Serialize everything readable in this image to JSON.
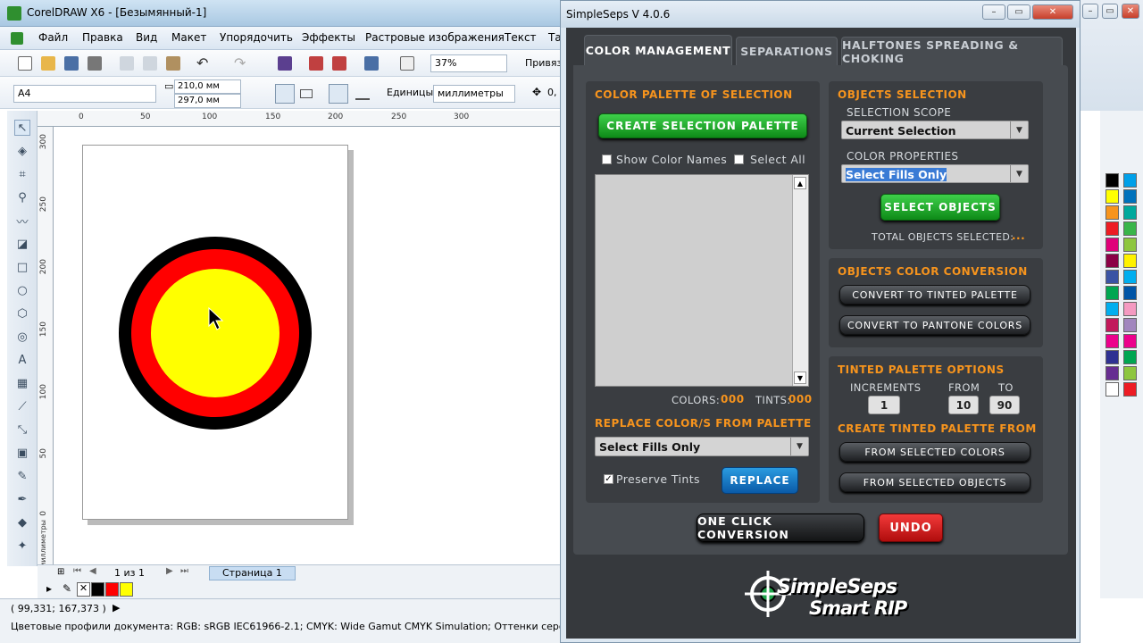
{
  "corel": {
    "window_title": "CorelDRAW X6 - [Безымянный-1]",
    "menu": [
      "Файл",
      "Правка",
      "Вид",
      "Макет",
      "Упорядочить",
      "Эффекты",
      "Растровые изображения",
      "Текст",
      "Та"
    ],
    "toolbar": {
      "zoom": "37%",
      "snap_label": "Привяз"
    },
    "property_bar": {
      "page_size": "A4",
      "width": "210,0 мм",
      "height": "297,0 мм",
      "units_label": "Единицы:",
      "units_value": "миллиметры",
      "nudge": "0,"
    },
    "ruler_h": [
      "0",
      "50",
      "100",
      "150",
      "200",
      "250",
      "300"
    ],
    "ruler_v": [
      "300",
      "250",
      "200",
      "150",
      "100",
      "50",
      "0"
    ],
    "ruler_unit": "миллиметры",
    "page_nav": {
      "counter": "1 из 1",
      "page_tab": "Страница 1"
    },
    "status": {
      "coords": "( 99,331; 167,373 )",
      "profiles": "Цветовые профили документа: RGB: sRGB IEC61966-2.1; CMYK: Wide Gamut CMYK Simulation; Оттенки серого: Gray Gamm"
    },
    "target_colors": {
      "outer": "#000000",
      "middle": "#ff0000",
      "inner": "#ffff00"
    },
    "palette_colors": [
      "#000000",
      "#ffff00",
      "#f7941d",
      "#ed1c24",
      "#e0007a",
      "#8b0046",
      "#3a53a4",
      "#00a651",
      "#00aeef",
      "#c2185b",
      "#ec008c",
      "#2e3192",
      "#662d91",
      "#ffffff",
      "#00a0e9",
      "#0072bc",
      "#00a99d",
      "#39b54a",
      "#8dc63f",
      "#fff200",
      "#00aeef",
      "#0054a6",
      "#f49ac1",
      "#a186be",
      "#ec008c",
      "#00a651",
      "#8dc63f",
      "#ed1c24"
    ]
  },
  "simpleseps": {
    "title": "SimpleSeps V 4.0.6",
    "tabs": [
      "COLOR MANAGEMENT",
      "SEPARATIONS",
      "HALFTONES SPREADING & CHOKING"
    ],
    "palette_group": {
      "header": "COLOR PALETTE OF SELECTION",
      "create_button": "CREATE SELECTION PALETTE",
      "show_color_names": "Show Color Names",
      "select_all": "Select All",
      "colors_label": "COLORS:",
      "colors_value": "000",
      "tints_label": "TINTS:",
      "tints_value": "000",
      "replace_header": "REPLACE COLOR/S FROM PALETTE",
      "replace_select": "Select Fills Only",
      "preserve_tints": "Preserve Tints",
      "replace_button": "REPLACE"
    },
    "objects_selection": {
      "header": "OBJECTS SELECTION",
      "scope_label": "SELECTION SCOPE",
      "scope_value": "Current Selection",
      "props_label": "COLOR PROPERTIES",
      "props_value": "Select Fills Only",
      "select_button": "SELECT OBJECTS",
      "total_label": "TOTAL OBJECTS SELECTED:",
      "total_value": "..."
    },
    "conversion": {
      "header": "OBJECTS COLOR CONVERSION",
      "to_tinted": "CONVERT TO TINTED PALETTE",
      "to_pantone": "CONVERT TO PANTONE COLORS"
    },
    "tinted_options": {
      "header": "TINTED PALETTE OPTIONS",
      "increments_label": "INCREMENTS",
      "from_label": "FROM",
      "to_label": "TO",
      "increments": "1",
      "from": "10",
      "to": "90",
      "create_header": "CREATE TINTED PALETTE FROM",
      "from_colors": "FROM SELECTED COLORS",
      "from_objects": "FROM SELECTED OBJECTS"
    },
    "one_click": "ONE CLICK CONVERSION",
    "undo": "UNDO",
    "logo_line1": "SimpleSeps",
    "logo_line2": "Smart RIP"
  }
}
